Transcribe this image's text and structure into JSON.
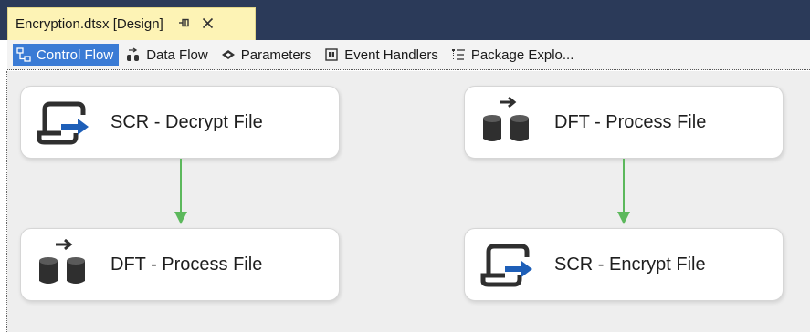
{
  "document_tab": {
    "title": "Encryption.dtsx [Design]",
    "pin_glyph": "⌘",
    "close_glyph": "✕"
  },
  "designer_tabs": [
    {
      "label": "Control Flow",
      "icon": "control-flow-icon",
      "active": true
    },
    {
      "label": "Data Flow",
      "icon": "data-flow-icon",
      "active": false
    },
    {
      "label": "Parameters",
      "icon": "parameters-icon",
      "active": false
    },
    {
      "label": "Event Handlers",
      "icon": "event-handlers-icon",
      "active": false
    },
    {
      "label": "Package Explo...",
      "icon": "package-explorer-icon",
      "active": false
    }
  ],
  "tasks": {
    "left_top": {
      "label": "SCR - Decrypt File",
      "icon": "script-task-icon"
    },
    "left_bottom": {
      "label": "DFT - Process File",
      "icon": "data-flow-task-icon"
    },
    "right_top": {
      "label": "DFT - Process File",
      "icon": "data-flow-task-icon"
    },
    "right_bottom": {
      "label": "SCR - Encrypt File",
      "icon": "script-task-icon"
    }
  },
  "colors": {
    "tabstrip": "#2b3a59",
    "doc_tab": "#fdf3b5",
    "active_tab": "#3a7bd5",
    "canvas": "#eeeeee",
    "precedence_arrow": "#5cb85c",
    "icon_dark": "#2f2f2f",
    "icon_blue": "#1e5fb8"
  }
}
